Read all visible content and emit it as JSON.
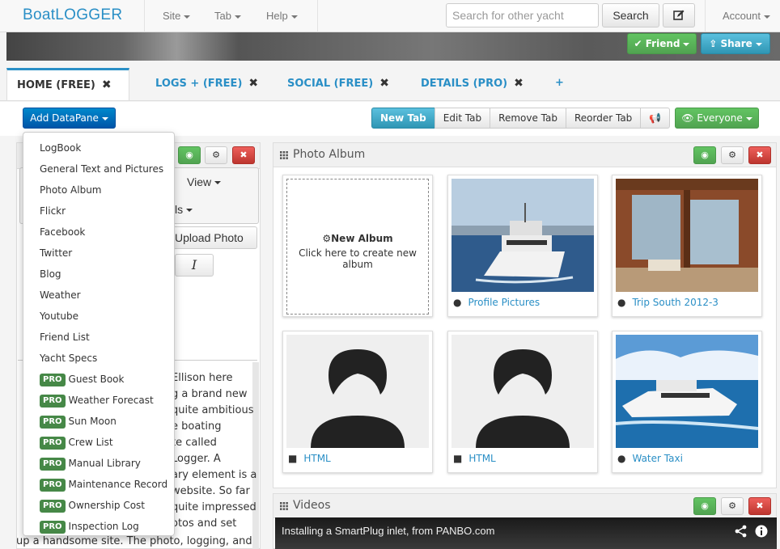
{
  "app": {
    "brand": "BoatLOGGER"
  },
  "nav": {
    "items": [
      "Site",
      "Tab",
      "Help"
    ],
    "search_placeholder": "Search for other yacht",
    "search_button": "Search",
    "account": "Account"
  },
  "banner": {
    "friend": "Friend",
    "share": "Share"
  },
  "tabs": [
    {
      "label": "HOME (FREE)",
      "active": true
    },
    {
      "label": "LOGS + (FREE)"
    },
    {
      "label": "SOCIAL (FREE)"
    },
    {
      "label": "DETAILS (PRO)"
    },
    {
      "label": "+"
    }
  ],
  "toolbar": {
    "add_datapane": "Add DataPane",
    "tab_buttons": [
      "New Tab",
      "Edit Tab",
      "Remove Tab",
      "Reorder Tab"
    ],
    "visibility": "Everyone"
  },
  "left_pane": {
    "view_menu": "View",
    "details_menu_fragment": "ls",
    "upload_button": "Upload Photo",
    "italic": "I",
    "text_lines": [
      "Ellison here",
      "g a brand new",
      "quite ambitious",
      "e boating",
      "te called",
      "Logger. A",
      "ary element is a",
      "website. So far",
      "quite impressed",
      "otos and set"
    ],
    "bottom_line": "up a handsome site. The photo, logging, and"
  },
  "dropdown": {
    "free_items": [
      "LogBook",
      "General Text and Pictures",
      "Photo Album",
      "Flickr",
      "Facebook",
      "Twitter",
      "Blog",
      "Weather",
      "Youtube",
      "Friend List",
      "Yacht Specs"
    ],
    "pro_badge": "PRO",
    "pro_items": [
      "Guest Book",
      "Weather Forecast",
      "Sun Moon",
      "Crew List",
      "Manual Library",
      "Maintenance Record",
      "Ownership Cost",
      "Inspection Log"
    ]
  },
  "photo_album": {
    "title": "Photo Album",
    "new_album_title": "New Album",
    "new_album_hint": "Click here to create new album",
    "albums": [
      {
        "caption": "Profile Pictures",
        "privacy": "globe-icon"
      },
      {
        "caption": "Trip South 2012-3",
        "privacy": "globe-icon"
      },
      {
        "caption": "HTML",
        "privacy": "lock-icon"
      },
      {
        "caption": "HTML",
        "privacy": "lock-icon"
      },
      {
        "caption": "Water Taxi",
        "privacy": "globe-icon"
      }
    ]
  },
  "videos": {
    "title": "Videos",
    "video_title": "Installing a SmartPlug inlet, from PANBO.com"
  },
  "colors": {
    "brand": "#2a8fc6",
    "success": "#51a351",
    "info": "#2f96b4",
    "danger": "#bd362f",
    "primary": "#0066bb"
  }
}
